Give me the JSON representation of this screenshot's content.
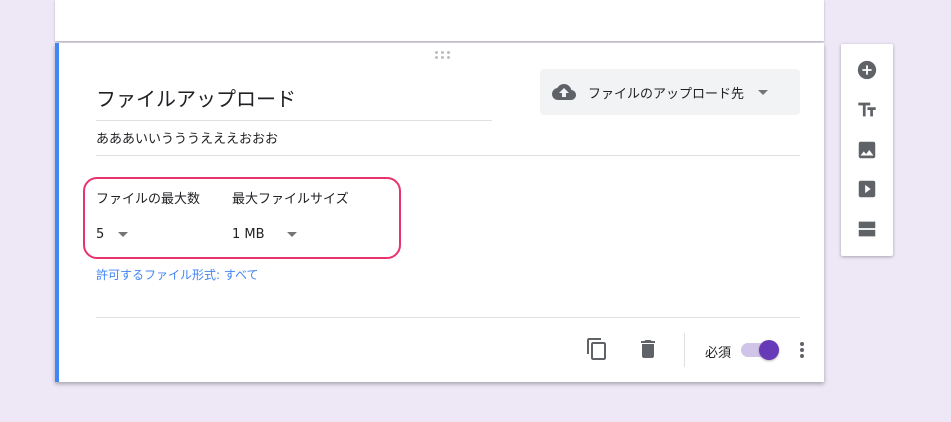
{
  "question": {
    "title": "ファイルアップロード",
    "description": "あああいいうううえええおおお",
    "destination_label": "ファイルのアップロード先"
  },
  "settings": {
    "max_files_label": "ファイルの最大数",
    "max_files_value": "5",
    "max_size_label": "最大ファイルサイズ",
    "max_size_value": "1 MB",
    "allowed_types_link": "許可するファイル形式: すべて"
  },
  "footer": {
    "required_label": "必須",
    "required_on": true
  },
  "colors": {
    "accent": "#673ab7",
    "highlight": "#e8336d",
    "link": "#4285f4",
    "background": "#ede7f6"
  }
}
